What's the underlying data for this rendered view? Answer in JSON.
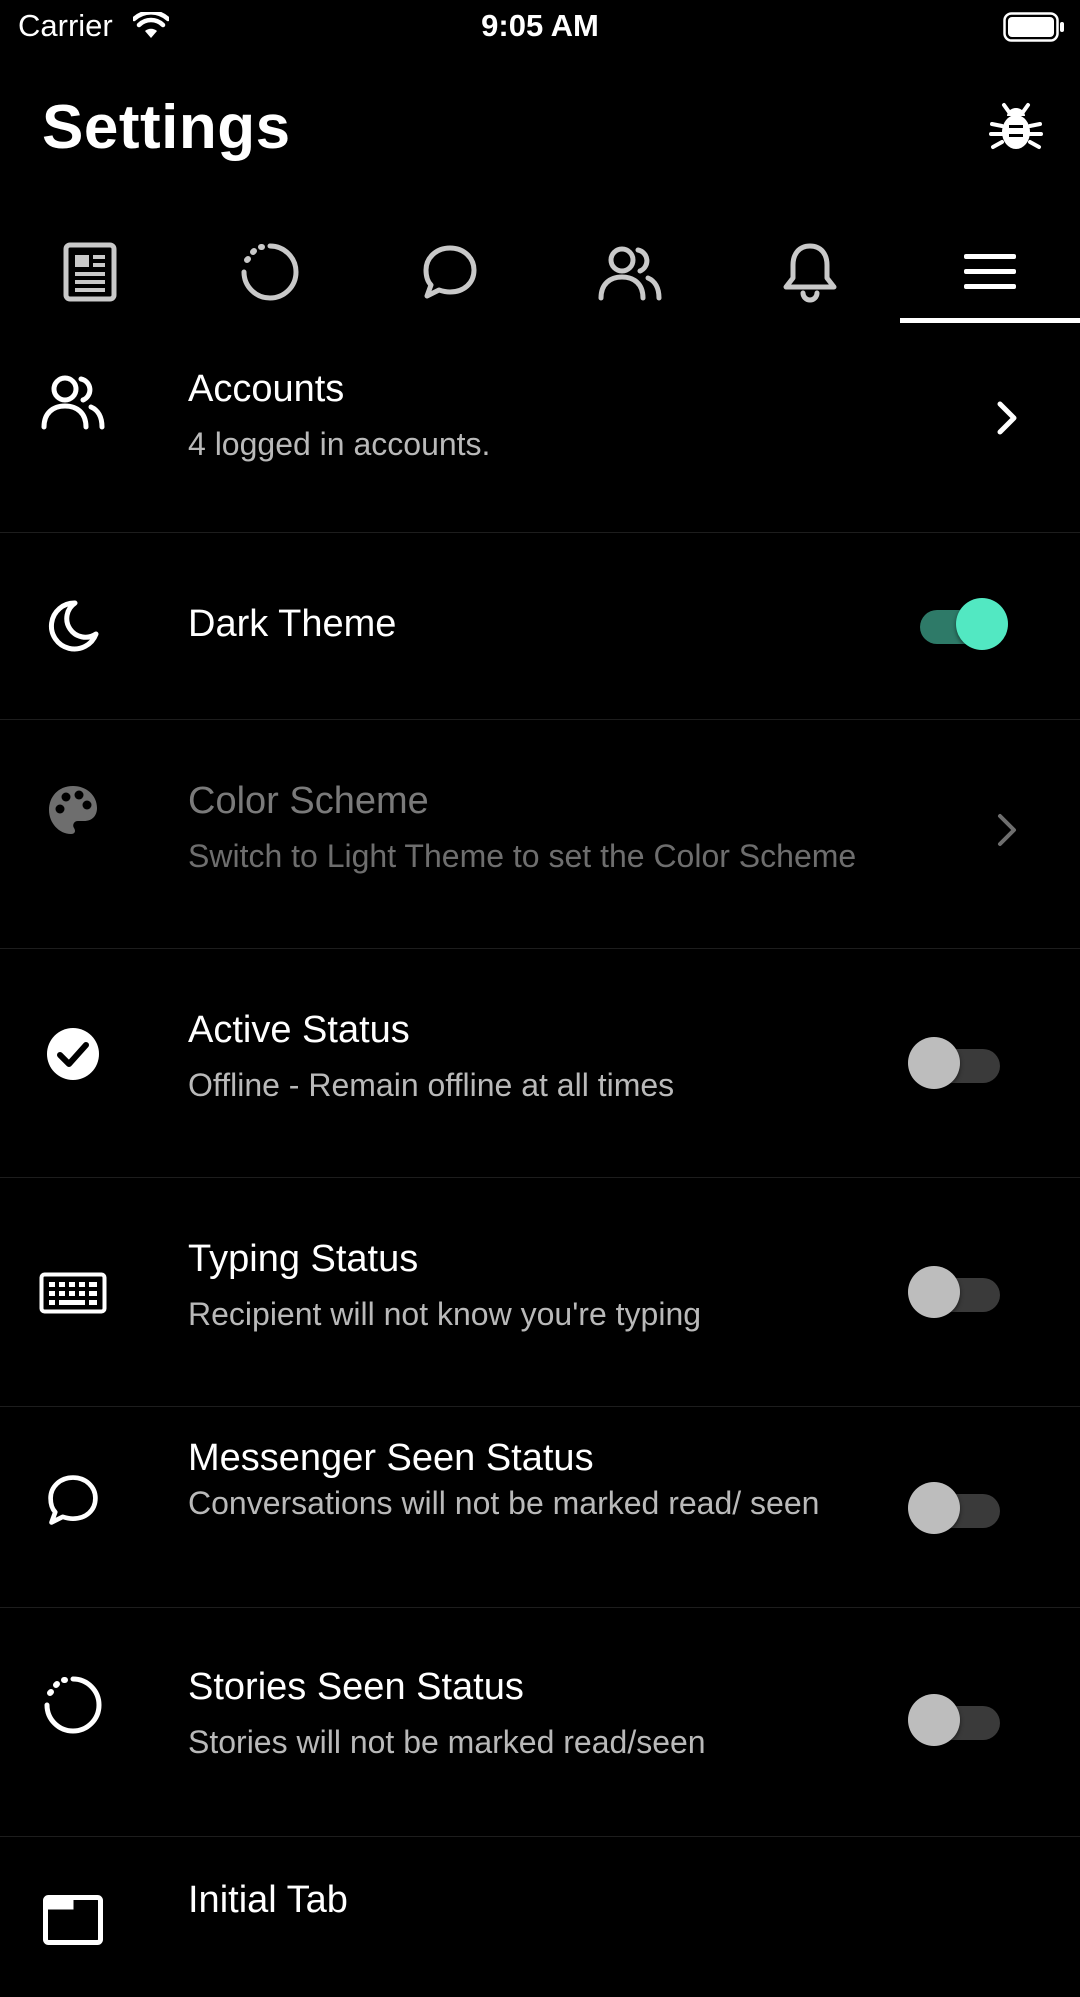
{
  "status_bar": {
    "carrier": "Carrier",
    "time": "9:05 AM",
    "wifi_icon": "wifi-icon",
    "battery_icon": "battery-icon"
  },
  "header": {
    "title": "Settings",
    "bug_icon": "bug-icon"
  },
  "tabs": [
    {
      "icon": "news-feed-icon",
      "selected": false
    },
    {
      "icon": "stories-ring-icon",
      "selected": false
    },
    {
      "icon": "chat-bubble-icon",
      "selected": false
    },
    {
      "icon": "people-icon",
      "selected": false
    },
    {
      "icon": "bell-icon",
      "selected": false
    },
    {
      "icon": "menu-icon",
      "selected": true
    }
  ],
  "settings": {
    "accounts": {
      "label": "Accounts",
      "sub": "4 logged in accounts.",
      "icon": "people-icon"
    },
    "dark_theme": {
      "label": "Dark Theme",
      "icon": "moon-icon",
      "enabled": true
    },
    "color_scheme": {
      "label": "Color Scheme",
      "sub": "Switch to Light Theme to set the Color Scheme",
      "icon": "palette-icon",
      "disabled": true
    },
    "active_status": {
      "label": "Active Status",
      "sub": "Offline - Remain offline at all times",
      "icon": "check-circle-icon",
      "enabled": false
    },
    "typing_status": {
      "label": "Typing Status",
      "sub": "Recipient will not know you're typing",
      "icon": "keyboard-icon",
      "enabled": false
    },
    "messenger_seen": {
      "label": "Messenger Seen Status",
      "sub": "Conversations will not be marked read/ seen",
      "icon": "chat-bubble-icon",
      "enabled": false
    },
    "stories_seen": {
      "label": "Stories Seen Status",
      "sub": "Stories will not be marked read/seen",
      "icon": "stories-ring-icon",
      "enabled": false
    },
    "initial_tab": {
      "label": "Initial Tab",
      "icon": "tab-icon"
    }
  },
  "colors": {
    "background": "#000000",
    "toggle_on_knob": "#52e8c2",
    "toggle_on_track": "#2e7a68",
    "toggle_off_knob": "#bdbdbd",
    "toggle_off_track": "#3a3a3a"
  }
}
